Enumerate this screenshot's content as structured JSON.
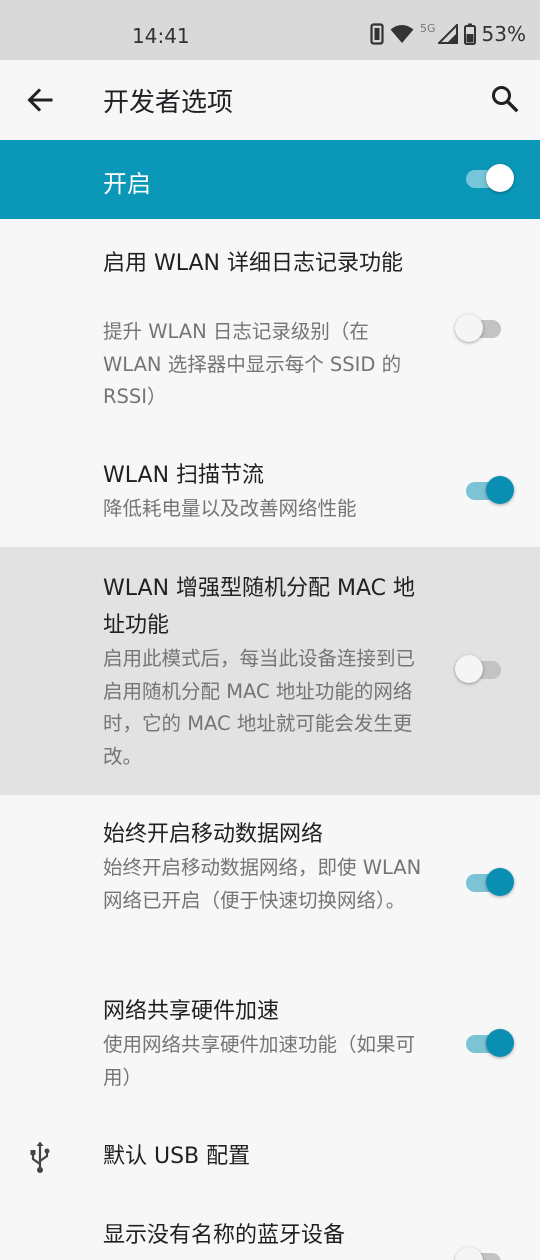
{
  "status_bar": {
    "time": "14:41",
    "network_label": "5G",
    "battery": "53%"
  },
  "app_bar": {
    "title": "开发者选项",
    "back_icon": "arrow-back-icon",
    "search_icon": "search-icon"
  },
  "master": {
    "label": "开启",
    "enabled": true
  },
  "settings": [
    {
      "title": "启用 WLAN 详细日志记录功能",
      "summary": "提升 WLAN 日志记录级别（在 WLAN 选择器中显示每个 SSID 的 RSSI）",
      "toggle": false
    },
    {
      "title": "WLAN 扫描节流",
      "summary": "降低耗电量以及改善网络性能",
      "toggle": true
    },
    {
      "title": "WLAN 增强型随机分配 MAC 地址功能",
      "summary": "启用此模式后，每当此设备连接到已启用随机分配 MAC 地址功能的网络时，它的 MAC 地址就可能会发生更改。",
      "toggle": false
    },
    {
      "title": "始终开启移动数据网络",
      "summary": "始终开启移动数据网络，即使 WLAN 网络已开启（便于快速切换网络）。",
      "toggle": true
    },
    {
      "title": "网络共享硬件加速",
      "summary": "使用网络共享硬件加速功能（如果可用）",
      "toggle": true
    },
    {
      "title": "默认 USB 配置",
      "icon": "usb-icon"
    },
    {
      "title": "显示没有名称的蓝牙设备",
      "toggle": false
    }
  ],
  "colors": {
    "accent": "#0a97b8",
    "toggle_on_thumb": "#0a8fb3",
    "toggle_on_track": "#7cc4d5",
    "highlight_row": "#e2e2e2"
  }
}
